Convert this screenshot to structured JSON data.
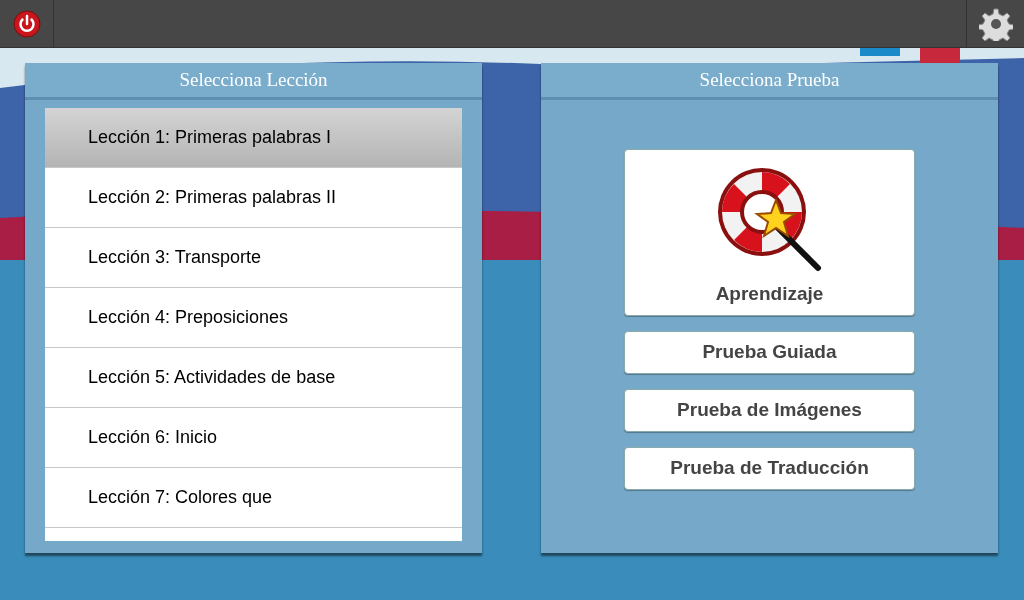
{
  "lessons_panel": {
    "title": "Selecciona Lección",
    "items": [
      {
        "label": "Lección 1: Primeras palabras I",
        "selected": true
      },
      {
        "label": "Lección 2: Primeras palabras II",
        "selected": false
      },
      {
        "label": "Lección 3: Transporte",
        "selected": false
      },
      {
        "label": "Lección 4: Preposiciones",
        "selected": false
      },
      {
        "label": "Lección 5: Actividades de base",
        "selected": false
      },
      {
        "label": "Lección 6: Inicio",
        "selected": false
      },
      {
        "label": "Lección 7: Colores que",
        "selected": false
      }
    ]
  },
  "tests_panel": {
    "title": "Selecciona Prueba",
    "options": [
      {
        "label": "Aprendizaje",
        "kind": "featured"
      },
      {
        "label": "Prueba Guiada",
        "kind": "plain"
      },
      {
        "label": "Prueba de Imágenes",
        "kind": "plain"
      },
      {
        "label": "Prueba de Traducción",
        "kind": "plain"
      }
    ]
  }
}
